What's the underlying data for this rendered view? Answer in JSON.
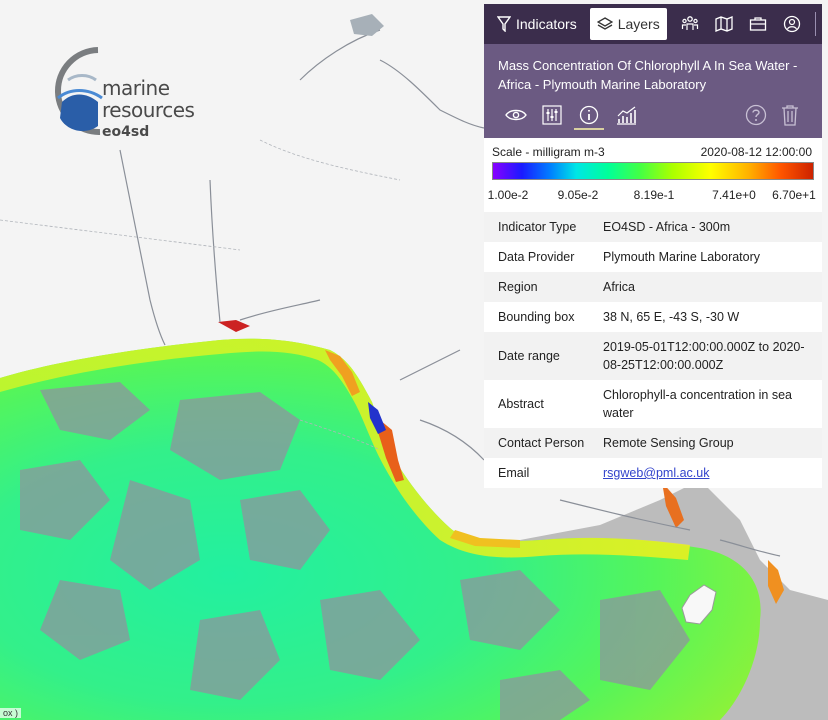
{
  "map": {
    "attribution": "ox )",
    "ocean_color": "#bcbcbc",
    "land_color": "#f4f4f4",
    "river_color": "#8a8f98"
  },
  "logo": {
    "line1": "marine",
    "line2": "resources",
    "line3": "eo4sd"
  },
  "topbar": {
    "tabs": [
      {
        "label": "Indicators",
        "icon": "filter-icon"
      },
      {
        "label": "Layers",
        "icon": "layers-icon",
        "active": true
      }
    ],
    "tools": [
      "people-icon",
      "map-icon",
      "briefcase-icon",
      "user-circle-icon",
      "collapse-arrow-icon"
    ]
  },
  "layer": {
    "title": "Mass Concentration Of Chlorophyll A In Sea Water - Africa - Plymouth Marine Laboratory",
    "icons": [
      "eye-icon",
      "sliders-icon",
      "info-icon",
      "chart-icon",
      "help-icon",
      "trash-icon"
    ],
    "selected_icon": "info-icon"
  },
  "legend": {
    "scale_label": "Scale - milligram m-3",
    "date": "2020-08-12 12:00:00",
    "ticks": [
      "1.00e-2",
      "9.05e-2",
      "8.19e-1",
      "7.41e+0",
      "6.70e+1"
    ]
  },
  "metadata": [
    {
      "key": "Indicator Type",
      "value": "EO4SD - Africa - 300m"
    },
    {
      "key": "Data Provider",
      "value": "Plymouth Marine Laboratory"
    },
    {
      "key": "Region",
      "value": "Africa"
    },
    {
      "key": "Bounding box",
      "value": "38 N, 65 E, -43 S, -30 W"
    },
    {
      "key": "Date range",
      "value": "2019-05-01T12:00:00.000Z to 2020-08-25T12:00:00.000Z"
    },
    {
      "key": "Abstract",
      "value": "Chlorophyll-a concentration in sea water"
    },
    {
      "key": "Contact Person",
      "value": "Remote Sensing Group"
    },
    {
      "key": "Email",
      "value": "rsgweb@pml.ac.uk",
      "link": true
    }
  ]
}
